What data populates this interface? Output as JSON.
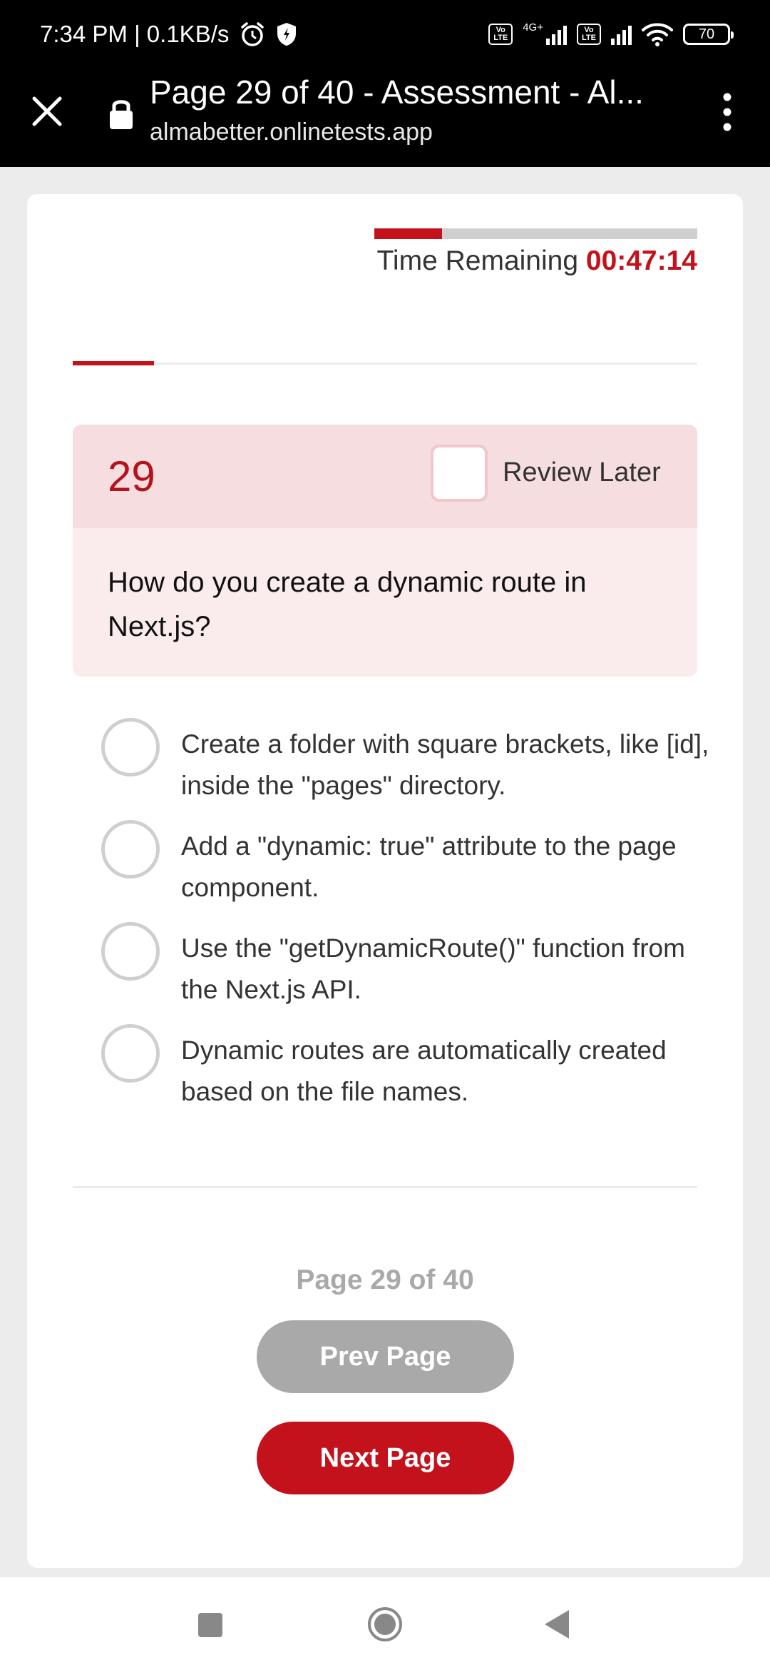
{
  "status_bar": {
    "time_speed": "7:34 PM | 0.1KB/s",
    "network_label": "4G+",
    "lte_label": "Vo LTE",
    "battery": "70"
  },
  "browser": {
    "tab_title": "Page 29 of 40 - Assessment - Al...",
    "url": "almabetter.onlinetests.app"
  },
  "timer": {
    "label": "Time Remaining",
    "value": "00:47:14",
    "progress_fraction": 0.21
  },
  "progress": {
    "fraction": 0.13
  },
  "question": {
    "number": "29",
    "review_label": "Review Later",
    "text": "How do you create a dynamic route in Next.js?"
  },
  "options": [
    {
      "text": "Create a folder with square brackets, like [id], inside the \"pages\" directory."
    },
    {
      "text": "Add a \"dynamic: true\" attribute to the page component."
    },
    {
      "text": "Use the \"getDynamicRoute()\" function from the Next.js API."
    },
    {
      "text": "Dynamic routes are automatically created based on the file names."
    }
  ],
  "pagination": {
    "indicator": "Page 29 of 40",
    "prev_label": "Prev Page",
    "next_label": "Next Page"
  },
  "colors": {
    "accent": "#c3121c",
    "muted": "#a9a9a9",
    "question_header_bg": "#f6dde0",
    "question_body_bg": "#faeced"
  },
  "icons": {
    "close": "close-icon",
    "lock": "lock-icon",
    "more": "more-vertical-icon",
    "alarm": "alarm-icon",
    "shield": "shield-icon",
    "wifi": "wifi-icon",
    "nav_recents": "square-icon",
    "nav_home": "circle-icon",
    "nav_back": "triangle-back-icon"
  }
}
